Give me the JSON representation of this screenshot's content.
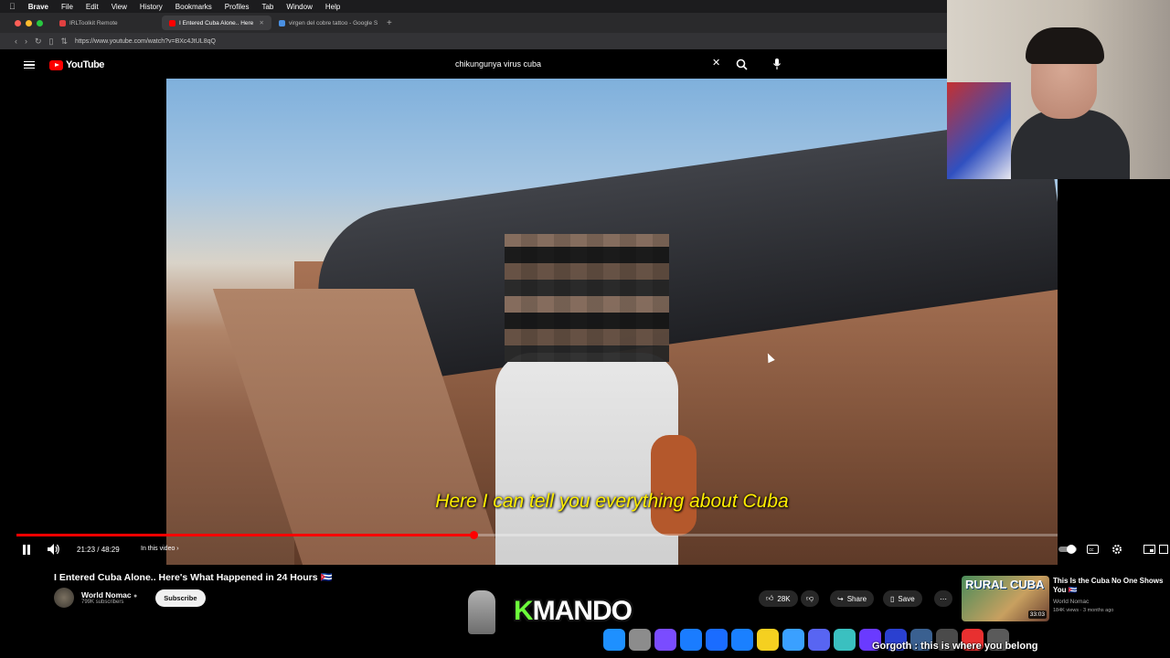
{
  "menubar": {
    "app": "Brave",
    "items": [
      "File",
      "Edit",
      "View",
      "History",
      "Bookmarks",
      "Profiles",
      "Tab",
      "Window",
      "Help"
    ]
  },
  "tabs": [
    {
      "label": "IRLToolkit Remote",
      "active": false,
      "favicon_color": "#e04040"
    },
    {
      "label": "I Entered Cuba Alone.. Here",
      "active": true,
      "favicon_color": "#ff0000"
    },
    {
      "label": "virgen del cobre tattoo - Google S",
      "active": false,
      "favicon_color": "#4a90e2"
    }
  ],
  "url": "https://www.youtube.com/watch?v=BXc4JtUL8qQ",
  "youtube": {
    "logo_text": "YouTube",
    "search_query": "chikungunya virus cuba"
  },
  "video": {
    "subtitle": "Here I can tell you everything about Cuba",
    "progress_fraction": 0.439,
    "time": "21:23 / 48:29",
    "in_this_video": "In this video"
  },
  "meta": {
    "title": "I Entered Cuba Alone.. Here's What Happened in 24 Hours 🇨🇺",
    "channel": "World Nomac",
    "subscribers": "799K subscribers",
    "subscribe_label": "Subscribe",
    "likes": "28K",
    "share_label": "Share",
    "save_label": "Save"
  },
  "overlay": {
    "brand_first": "K",
    "brand_rest": "MANDO",
    "chat_line": "Gorgoth : this is where you belong"
  },
  "recommendation": {
    "thumb_text": "RURAL CUBA",
    "duration": "33:03",
    "title": "This Is the Cuba No One Shows You 🇨🇺",
    "channel": "World Nomac",
    "meta": "184K views · 3 months ago"
  },
  "dock_icon_colors": [
    "#1e90ff",
    "#8c8c8c",
    "#7a4cff",
    "#1a7cff",
    "#1a6cff",
    "#1a80ff",
    "#f5d020",
    "#3aa0ff",
    "#5865f2",
    "#3ac0c0",
    "#6a3aff",
    "#2a40d0",
    "#3a6090",
    "#4a4a4a",
    "#e83030",
    "#5a5a5a"
  ]
}
